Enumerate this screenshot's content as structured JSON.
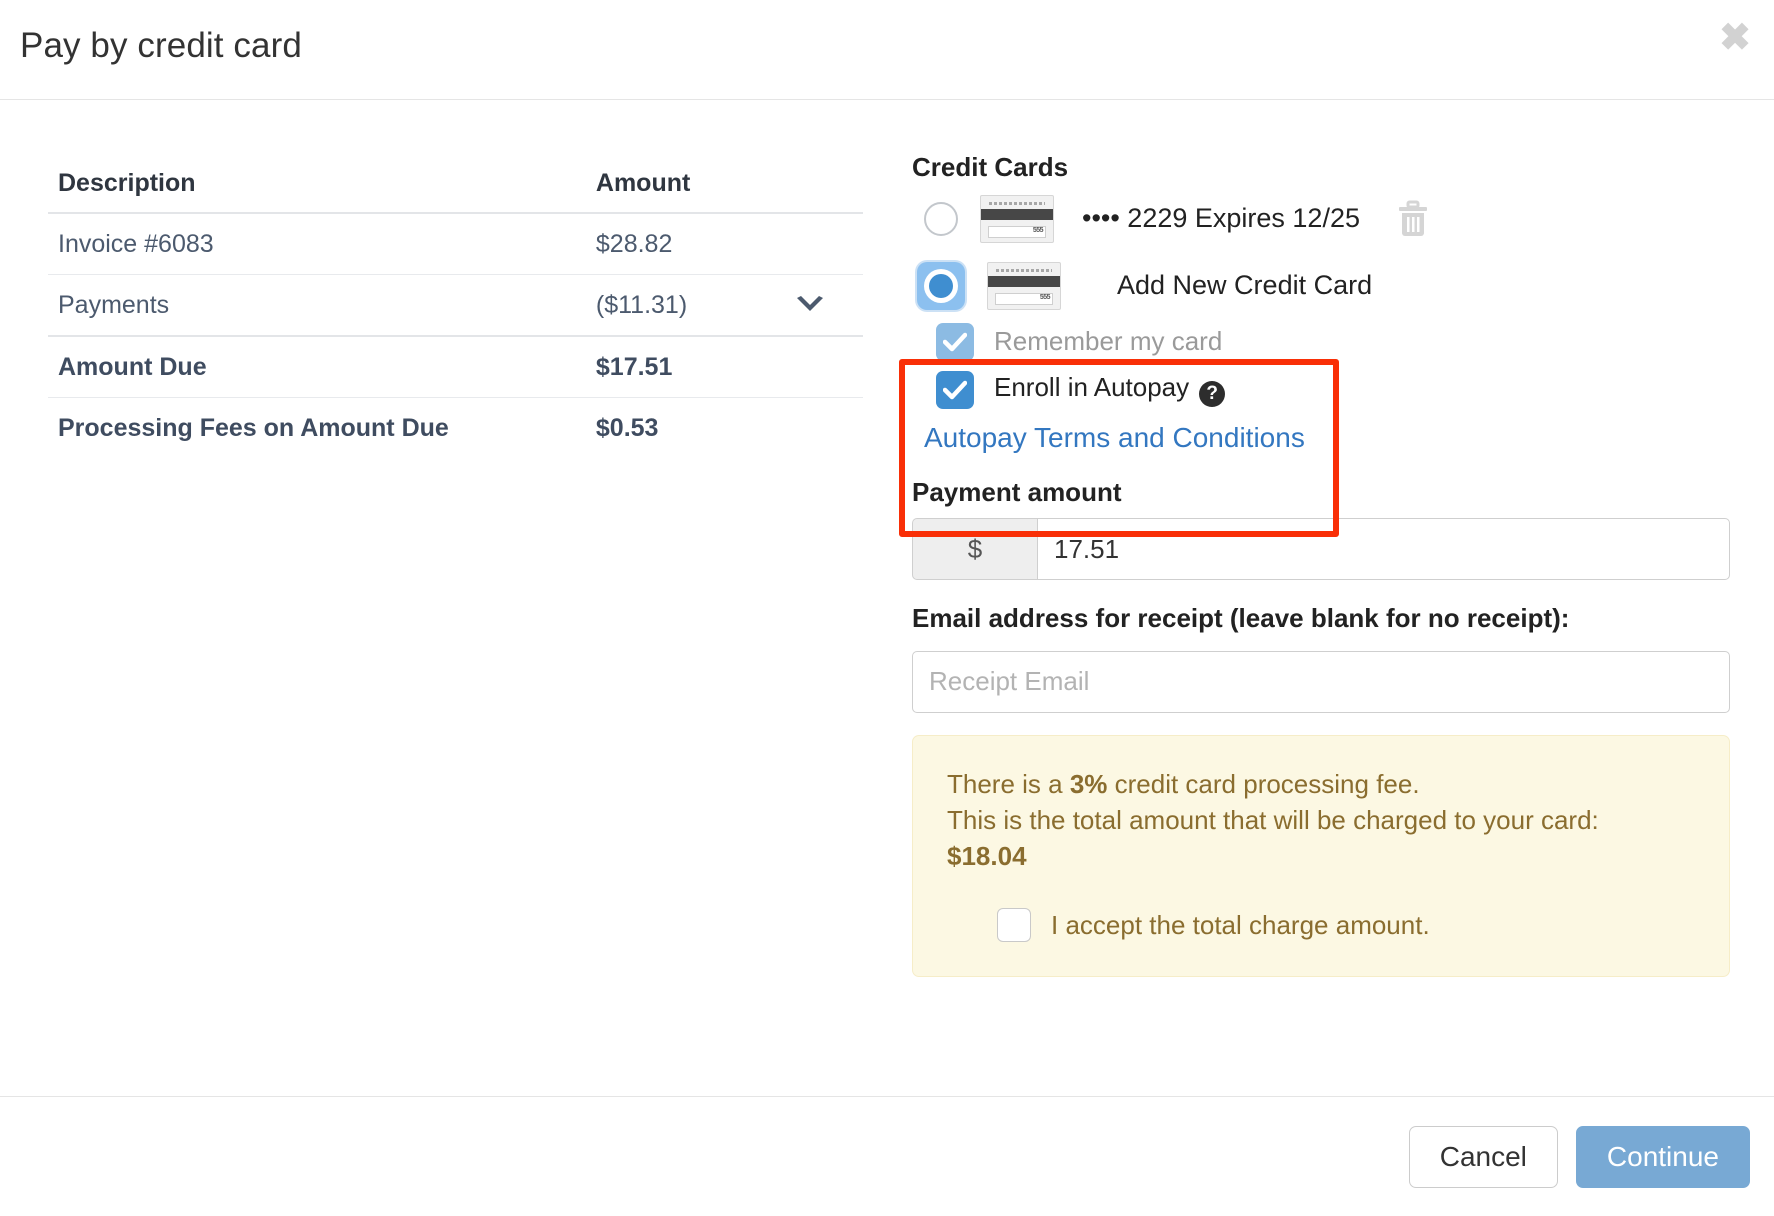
{
  "modal": {
    "title": "Pay by credit card",
    "close_icon": "close-icon"
  },
  "summary_table": {
    "headers": {
      "description": "Description",
      "amount": "Amount"
    },
    "rows": [
      {
        "description": "Invoice #6083",
        "amount": "$28.82",
        "expandable": false
      },
      {
        "description": "Payments",
        "amount": "($11.31)",
        "expandable": true
      }
    ],
    "totals": [
      {
        "description": "Amount Due",
        "amount": "$17.51"
      },
      {
        "description": "Processing Fees on Amount Due",
        "amount": "$0.53"
      }
    ]
  },
  "credit_cards": {
    "heading": "Credit Cards",
    "saved_card": {
      "masked": "••••",
      "last4": "2229",
      "expires_label": "Expires",
      "expires": "12/25",
      "full_label": "•••• 2229 Expires 12/25",
      "selected": false,
      "delete_icon": "trash-icon"
    },
    "add_new": {
      "label": "Add New Credit Card",
      "selected": true
    },
    "remember_my_card": {
      "label": "Remember my card",
      "checked": true,
      "disabled": true
    },
    "enroll_autopay": {
      "label": "Enroll in Autopay",
      "checked": true,
      "help_icon": "question-mark-icon",
      "help_glyph": "?"
    },
    "terms_link": "Autopay Terms and Conditions",
    "highlight_color": "#f92f07"
  },
  "payment_amount": {
    "label": "Payment amount",
    "currency_symbol": "$",
    "value": "17.51"
  },
  "receipt_email": {
    "label": "Email address for receipt (leave blank for no receipt):",
    "value": "",
    "placeholder": "Receipt Email"
  },
  "fee_notice": {
    "line1_prefix": "There is a ",
    "line1_strong": "3%",
    "line1_suffix": " credit card processing fee.",
    "line2": "This is the total amount that will be charged to your card:",
    "total": "$18.04",
    "accept_label": "I accept the total charge amount.",
    "accept_checked": false,
    "background": "#fcf8e3",
    "text_color": "#8a6d2f"
  },
  "footer": {
    "cancel_label": "Cancel",
    "continue_label": "Continue",
    "continue_color": "#78a9d4"
  }
}
